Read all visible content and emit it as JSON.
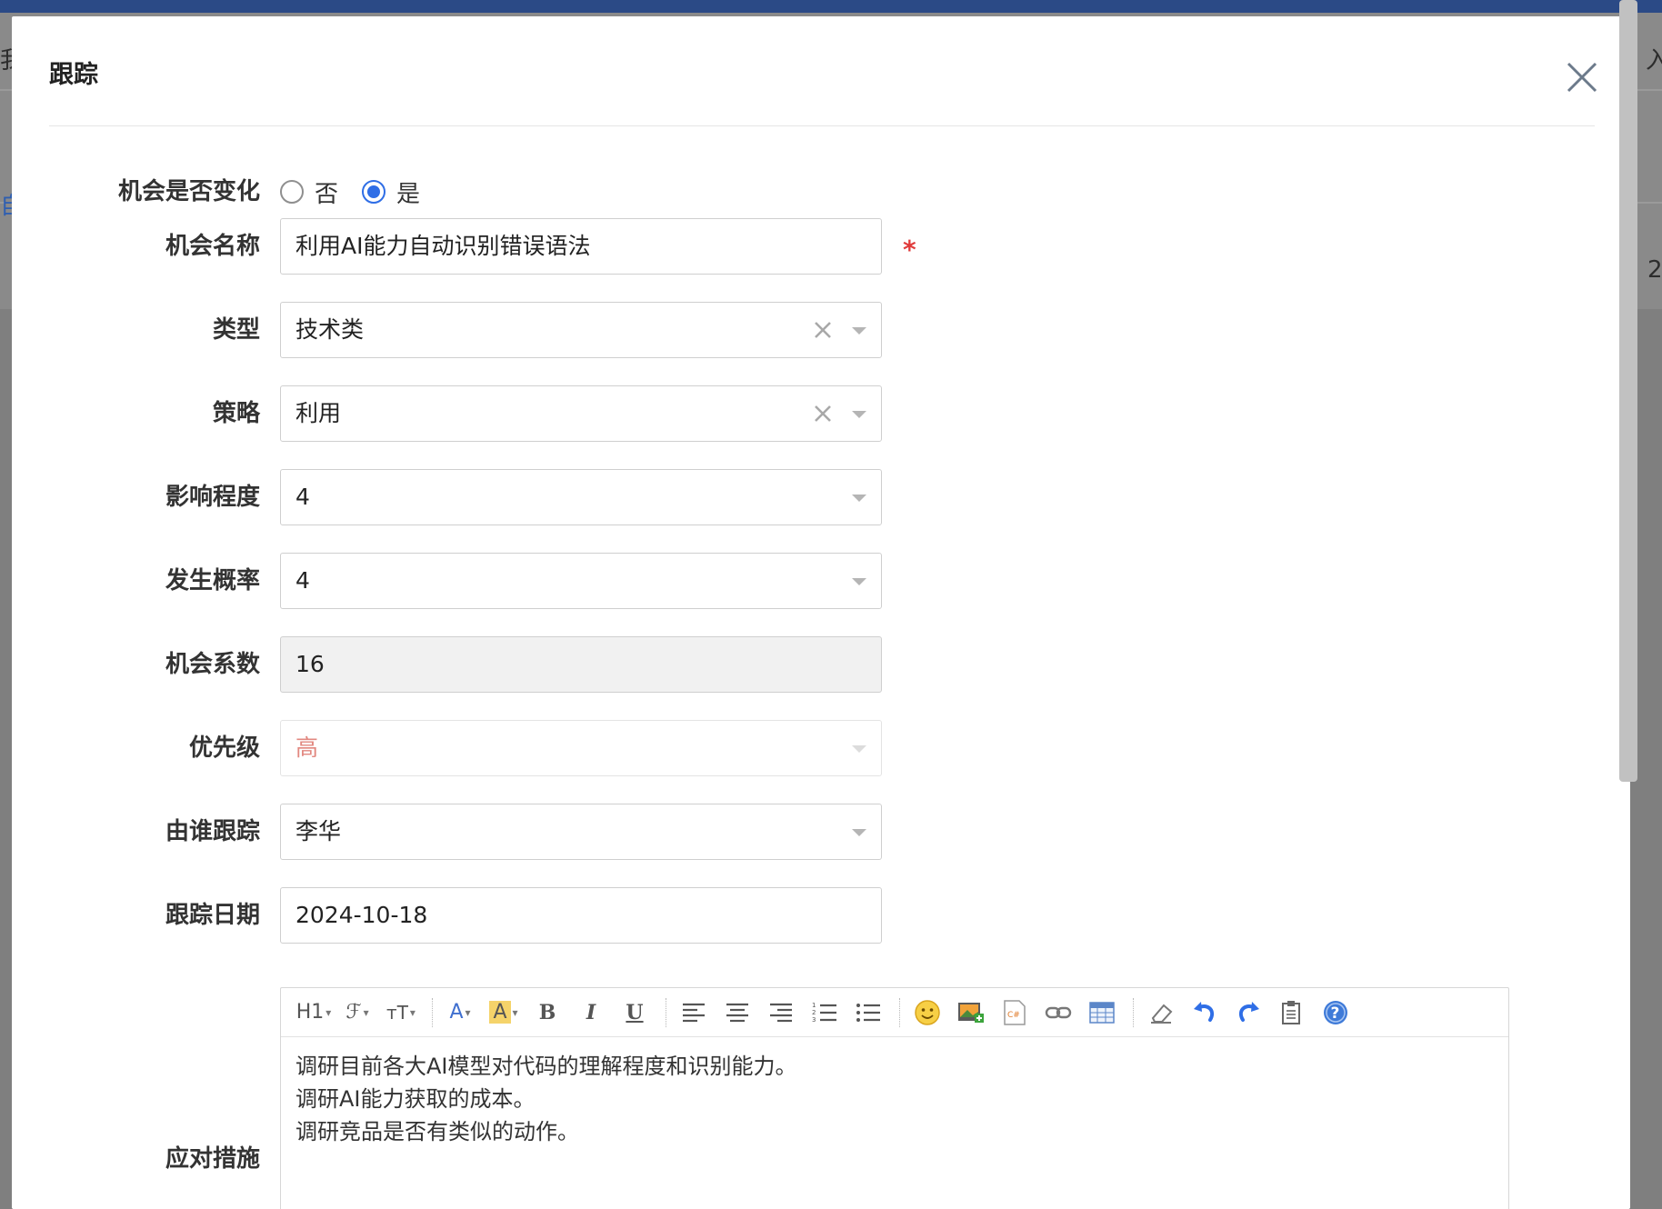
{
  "backdrop": {
    "left_chars": [
      "我",
      "自"
    ],
    "right_chars": [
      "入",
      "2"
    ]
  },
  "modal": {
    "title": "跟踪",
    "close_icon": "close-icon"
  },
  "form": {
    "changed": {
      "label": "机会是否变化",
      "options": [
        {
          "label": "否",
          "checked": false
        },
        {
          "label": "是",
          "checked": true
        }
      ]
    },
    "name": {
      "label": "机会名称",
      "value": "利用AI能力自动识别错误语法",
      "required_mark": "*"
    },
    "type": {
      "label": "类型",
      "value": "技术类"
    },
    "strategy": {
      "label": "策略",
      "value": "利用"
    },
    "impact": {
      "label": "影响程度",
      "value": "4"
    },
    "probability": {
      "label": "发生概率",
      "value": "4"
    },
    "coefficient": {
      "label": "机会系数",
      "value": "16"
    },
    "priority": {
      "label": "优先级",
      "value": "高",
      "color": "#e28880"
    },
    "owner": {
      "label": "由谁跟踪",
      "value": "李华"
    },
    "date": {
      "label": "跟踪日期",
      "value": "2024-10-18"
    },
    "measures": {
      "label": "应对措施",
      "lines": [
        "调研目前各大AI模型对代码的理解程度和识别能力。",
        "调研AI能力获取的成本。",
        "调研竞品是否有类似的动作。"
      ]
    }
  },
  "toolbar": {
    "heading": "H1",
    "font_family": "ℱ",
    "font_size": "тT",
    "font_color": "A",
    "highlight": "A",
    "bold": "B",
    "italic": "I",
    "underline": "U",
    "highlight_color": "#f5d36a",
    "font_color_hex": "#3f6fcf"
  },
  "colors": {
    "accent": "#2f6ee6",
    "required": "#e03b3b",
    "topbar": "#2b4a86"
  }
}
